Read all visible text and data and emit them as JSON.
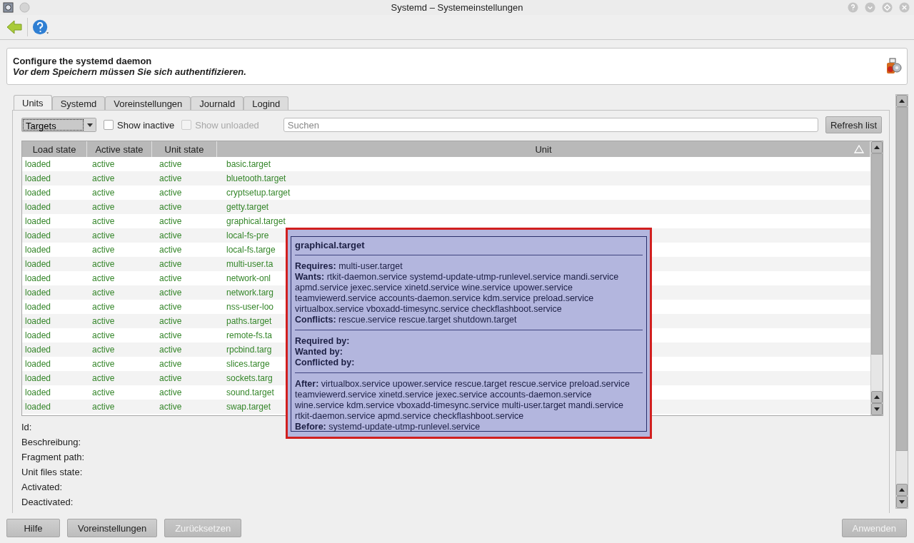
{
  "window": {
    "title": "Systemd – Systemeinstellungen"
  },
  "header": {
    "title": "Configure the systemd daemon",
    "subtitle": "Vor dem Speichern müssen Sie sich authentifizieren."
  },
  "tabs": [
    {
      "label": "Units",
      "selected": true
    },
    {
      "label": "Systemd",
      "selected": false
    },
    {
      "label": "Voreinstellungen",
      "selected": false
    },
    {
      "label": "Journald",
      "selected": false
    },
    {
      "label": "Logind",
      "selected": false
    }
  ],
  "filter": {
    "unit_type": "Targets",
    "checkboxes": [
      {
        "label": "Show inactive",
        "checked": false,
        "disabled": false
      },
      {
        "label": "Show unloaded",
        "checked": false,
        "disabled": true
      }
    ],
    "search": {
      "placeholder": "Suchen"
    },
    "refresh_button": "Refresh list"
  },
  "table": {
    "columns": [
      "Load state",
      "Active state",
      "Unit state",
      "Unit"
    ],
    "rows": [
      [
        "loaded",
        "active",
        "active",
        "basic.target"
      ],
      [
        "loaded",
        "active",
        "active",
        "bluetooth.target"
      ],
      [
        "loaded",
        "active",
        "active",
        "cryptsetup.target"
      ],
      [
        "loaded",
        "active",
        "active",
        "getty.target"
      ],
      [
        "loaded",
        "active",
        "active",
        "graphical.target"
      ],
      [
        "loaded",
        "active",
        "active",
        "local-fs-pre"
      ],
      [
        "loaded",
        "active",
        "active",
        "local-fs.targe"
      ],
      [
        "loaded",
        "active",
        "active",
        "multi-user.ta"
      ],
      [
        "loaded",
        "active",
        "active",
        "network-onl"
      ],
      [
        "loaded",
        "active",
        "active",
        "network.targ"
      ],
      [
        "loaded",
        "active",
        "active",
        "nss-user-loo"
      ],
      [
        "loaded",
        "active",
        "active",
        "paths.target"
      ],
      [
        "loaded",
        "active",
        "active",
        "remote-fs.ta"
      ],
      [
        "loaded",
        "active",
        "active",
        "rpcbind.targ"
      ],
      [
        "loaded",
        "active",
        "active",
        "slices.targe"
      ],
      [
        "loaded",
        "active",
        "active",
        "sockets.targ"
      ],
      [
        "loaded",
        "active",
        "active",
        "sound.target"
      ],
      [
        "loaded",
        "active",
        "active",
        "swap.target"
      ]
    ]
  },
  "tooltip": {
    "title": "graphical.target",
    "sections": [
      [
        "**Requires:** multi-user.target",
        "**Wants:** rtkit-daemon.service systemd-update-utmp-runlevel.service mandi.service",
        "apmd.service jexec.service xinetd.service wine.service upower.service",
        "teamviewerd.service accounts-daemon.service kdm.service preload.service",
        "virtualbox.service vboxadd-timesync.service checkflashboot.service",
        "**Conflicts:** rescue.service rescue.target shutdown.target"
      ],
      [
        "**Required by:**",
        "**Wanted by:**",
        "**Conflicted by:**"
      ],
      [
        "**After:** virtualbox.service upower.service rescue.target rescue.service preload.service",
        "teamviewerd.service xinetd.service jexec.service accounts-daemon.service",
        "wine.service kdm.service vboxadd-timesync.service multi-user.target mandi.service",
        "rtkit-daemon.service apmd.service checkflashboot.service",
        "**Before:** systemd-update-utmp-runlevel.service"
      ]
    ]
  },
  "details": [
    "Id:",
    "Beschreibung:",
    "Fragment path:",
    "Unit files state:",
    "Activated:",
    "Deactivated:"
  ],
  "buttons": [
    {
      "label": "Hilfe",
      "disabled": false
    },
    {
      "label": "Voreinstellungen",
      "disabled": false
    },
    {
      "label": "Zurücksetzen",
      "disabled": true
    }
  ],
  "apply_button": {
    "label": "Anwenden",
    "disabled": true
  }
}
